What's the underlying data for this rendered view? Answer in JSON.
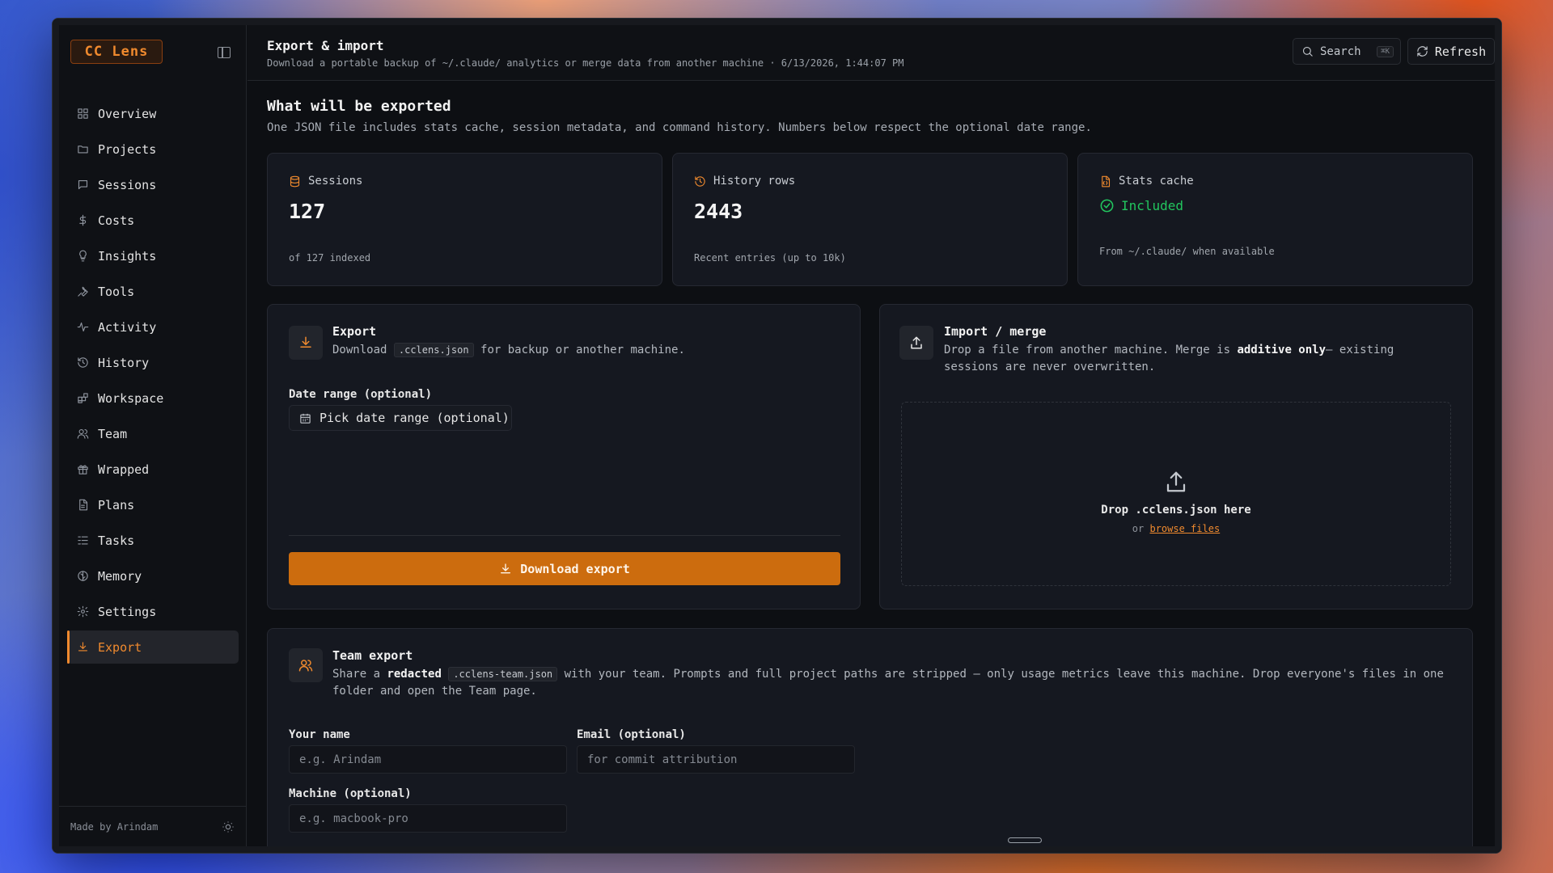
{
  "app": {
    "logo": "CC Lens",
    "footer_text": "Made by Arindam"
  },
  "sidebar": {
    "items": [
      {
        "label": "Overview",
        "icon": "grid-icon"
      },
      {
        "label": "Projects",
        "icon": "folder-icon"
      },
      {
        "label": "Sessions",
        "icon": "message-icon"
      },
      {
        "label": "Costs",
        "icon": "dollar-icon"
      },
      {
        "label": "Insights",
        "icon": "bulb-icon"
      },
      {
        "label": "Tools",
        "icon": "wrench-icon"
      },
      {
        "label": "Activity",
        "icon": "activity-icon"
      },
      {
        "label": "History",
        "icon": "history-icon"
      },
      {
        "label": "Workspace",
        "icon": "blocks-icon"
      },
      {
        "label": "Team",
        "icon": "users-icon"
      },
      {
        "label": "Wrapped",
        "icon": "gift-icon"
      },
      {
        "label": "Plans",
        "icon": "file-icon"
      },
      {
        "label": "Tasks",
        "icon": "list-icon"
      },
      {
        "label": "Memory",
        "icon": "brain-icon"
      },
      {
        "label": "Settings",
        "icon": "gear-icon"
      },
      {
        "label": "Export",
        "icon": "download-icon",
        "active": true
      }
    ]
  },
  "header": {
    "title": "Export & import",
    "subtitle": "Download a portable backup of ~/.claude/ analytics or merge data from another machine · 6/13/2026, 1:44:07 PM",
    "search_label": "Search",
    "search_shortcut": "⌘K",
    "refresh_label": "Refresh"
  },
  "export_summary": {
    "title": "What will be exported",
    "description": "One JSON file includes stats cache, session metadata, and command history. Numbers below respect the optional date range.",
    "stats": {
      "sessions": {
        "label": "Sessions",
        "value": "127",
        "note": "of 127 indexed"
      },
      "history": {
        "label": "History rows",
        "value": "2443",
        "note": "Recent entries (up to 10k)"
      },
      "cache": {
        "label": "Stats cache",
        "value": "Included",
        "note": "From ~/.claude/ when available"
      }
    }
  },
  "export_card": {
    "title": "Export",
    "desc_prefix": "Download",
    "desc_code": ".cclens.json",
    "desc_suffix": "for backup or another machine.",
    "date_label": "Date range (optional)",
    "date_button": "Pick date range (optional)",
    "download_button": "Download export"
  },
  "import_card": {
    "title": "Import / merge",
    "desc_prefix": "Drop a file from another machine. Merge is",
    "desc_strong": "additive only",
    "desc_suffix": "— existing sessions are never overwritten.",
    "drop_text": "Drop .cclens.json here",
    "drop_or": "or",
    "browse_link": "browse files"
  },
  "team_card": {
    "title": "Team export",
    "desc_prefix": "Share a",
    "desc_strong": "redacted",
    "desc_code": ".cclens-team.json",
    "desc_suffix": "with your team. Prompts and full project paths are stripped — only usage metrics leave this machine. Drop everyone's files in one folder and open the Team page.",
    "name_label": "Your name",
    "name_placeholder": "e.g. Arindam",
    "email_label": "Email (optional)",
    "email_placeholder": "for commit attribution",
    "machine_label": "Machine (optional)",
    "machine_placeholder": "e.g. macbook-pro"
  },
  "colors": {
    "accent": "#f08a2e",
    "button": "#cc6c0e",
    "success": "#22c55e"
  }
}
